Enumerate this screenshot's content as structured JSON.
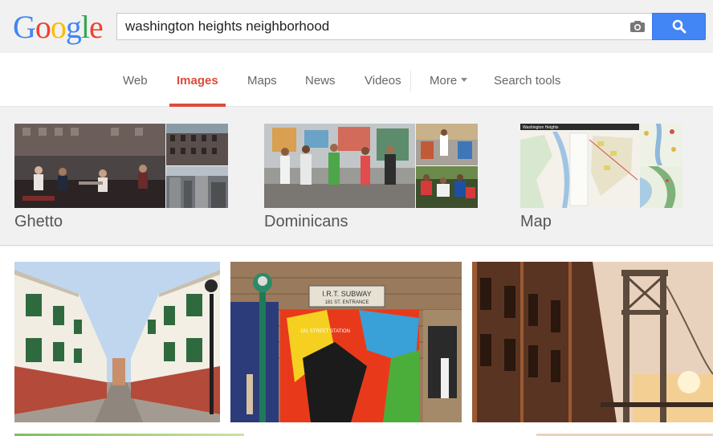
{
  "logo": {
    "letters": [
      {
        "char": "G",
        "color": "#4285f4"
      },
      {
        "char": "o",
        "color": "#ea4335"
      },
      {
        "char": "o",
        "color": "#fbbc05"
      },
      {
        "char": "g",
        "color": "#4285f4"
      },
      {
        "char": "l",
        "color": "#34a853"
      },
      {
        "char": "e",
        "color": "#ea4335"
      }
    ]
  },
  "search": {
    "query": "washington heights neighborhood",
    "camera_icon": "camera-icon",
    "button_icon": "magnifier-icon"
  },
  "tabs": [
    {
      "label": "Web",
      "active": false
    },
    {
      "label": "Images",
      "active": true
    },
    {
      "label": "Maps",
      "active": false
    },
    {
      "label": "News",
      "active": false
    },
    {
      "label": "Videos",
      "active": false
    },
    {
      "label": "More",
      "active": false
    },
    {
      "label": "Search tools",
      "active": false
    }
  ],
  "related": [
    {
      "label": "Ghetto"
    },
    {
      "label": "Dominicans"
    },
    {
      "label": "Map"
    }
  ],
  "map_thumb_title": "Washington Heights",
  "subway_sign": {
    "line1": "I.R.T. SUBWAY",
    "line2": "181 ST. ENTRANCE",
    "line3": "181 STREET STATION"
  },
  "colors": {
    "accent": "#dd4b39",
    "search_button": "#4285f4",
    "tab_text": "#666666"
  }
}
